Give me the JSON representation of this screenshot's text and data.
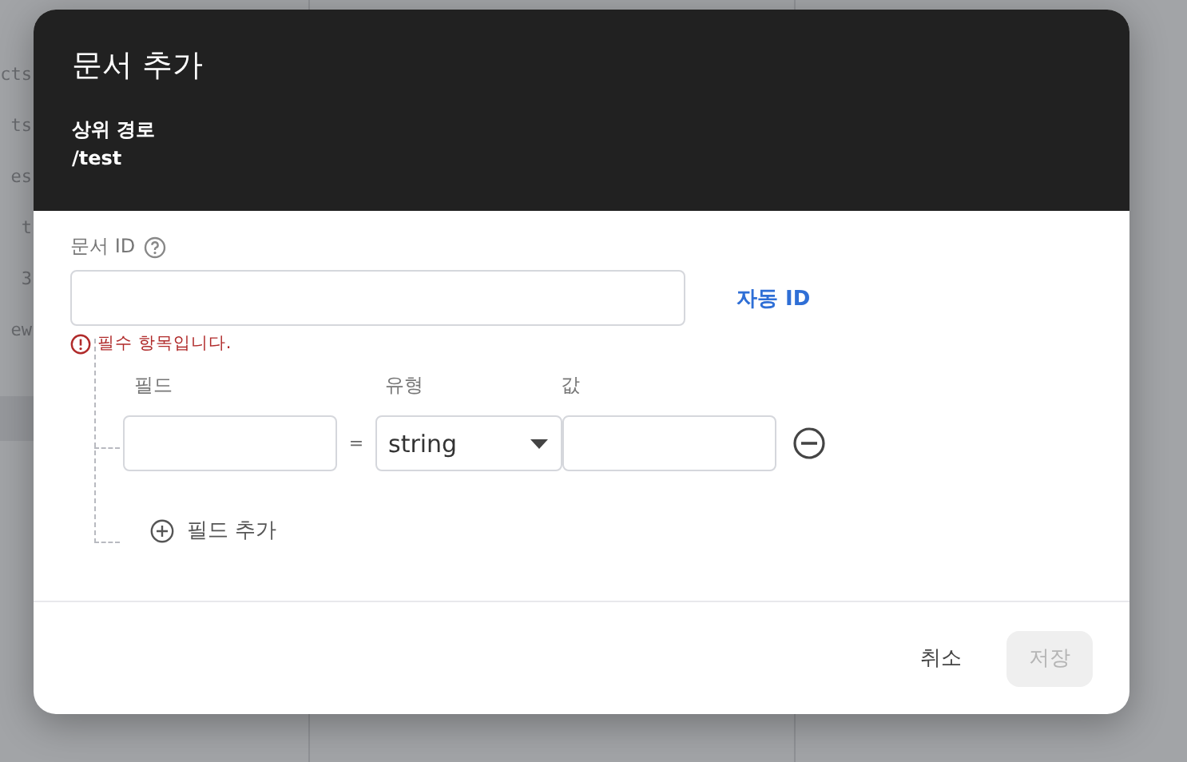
{
  "background_list": [
    "cts",
    "ts",
    "es",
    "t",
    "3",
    "ew"
  ],
  "dialog": {
    "title": "문서 추가",
    "parent_path_label": "상위 경로",
    "parent_path": "/test",
    "document_id": {
      "label": "문서 ID",
      "error": "필수 항목입니다.",
      "auto_id_button": "자동 ID"
    },
    "field_columns": [
      "필드",
      "유형",
      "값"
    ],
    "fields": [
      {
        "equals": "=",
        "type": "string"
      }
    ],
    "add_field": "필드 추가",
    "buttons": [
      {
        "label": "취소",
        "disabled": false
      },
      {
        "label": "저장",
        "disabled": true
      }
    ]
  }
}
